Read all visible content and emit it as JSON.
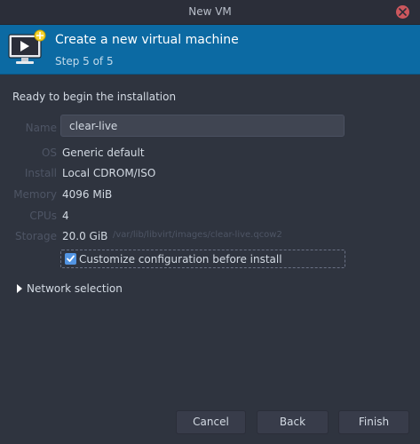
{
  "window": {
    "title": "New VM"
  },
  "banner": {
    "heading": "Create a new virtual machine",
    "step": "Step 5 of 5"
  },
  "summary": {
    "intro": "Ready to begin the installation",
    "name_label": "Name",
    "name_value": "clear-live",
    "os_label": "OS",
    "os_value": "Generic default",
    "install_label": "Install",
    "install_value": "Local CDROM/ISO",
    "memory_label": "Memory",
    "memory_value": "4096 MiB",
    "cpus_label": "CPUs",
    "cpus_value": "4",
    "storage_label": "Storage",
    "storage_value": "20.0 GiB",
    "storage_path": "/var/lib/libvirt/images/clear-live.qcow2"
  },
  "customize": {
    "label": "Customize configuration before install",
    "checked": true
  },
  "network": {
    "label": "Network selection",
    "expanded": false
  },
  "buttons": {
    "cancel": "Cancel",
    "back": "Back",
    "finish": "Finish"
  },
  "colors": {
    "banner": "#0c6aa3",
    "accent": "#5294e2",
    "close": "#cc575d",
    "background": "#2f343f"
  }
}
